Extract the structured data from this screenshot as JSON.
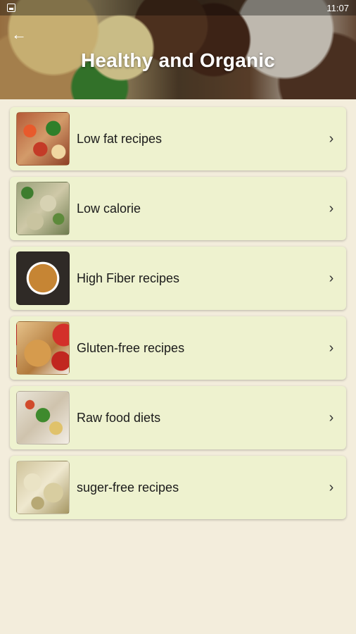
{
  "status_bar": {
    "time": "11:07"
  },
  "header": {
    "title": "Healthy and Organic",
    "back_icon": "arrow-left-icon"
  },
  "items": [
    {
      "label": "Low fat recipes",
      "icon": "chevron-right-icon"
    },
    {
      "label": "Low calorie",
      "icon": "chevron-right-icon"
    },
    {
      "label": "High Fiber recipes",
      "icon": "chevron-right-icon"
    },
    {
      "label": "Gluten-free recipes",
      "icon": "chevron-right-icon"
    },
    {
      "label": "Raw food diets",
      "icon": "chevron-right-icon"
    },
    {
      "label": "suger-free recipes",
      "icon": "chevron-right-icon"
    }
  ],
  "colors": {
    "background": "#f3eddc",
    "card": "#eef2cf",
    "title_text": "#ffffff"
  }
}
